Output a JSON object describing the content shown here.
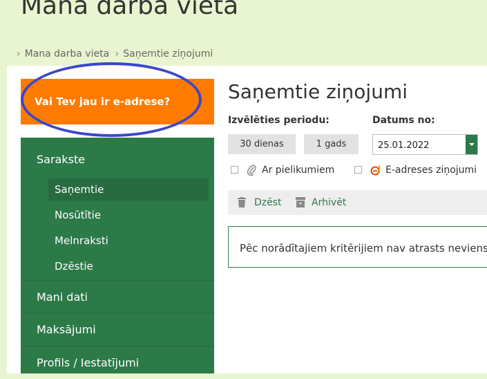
{
  "header": {
    "title": "Mana darba vieta"
  },
  "breadcrumb": {
    "items": [
      "Mana darba vieta",
      "Saņemtie ziņojumi"
    ],
    "separator": "›"
  },
  "promo": {
    "text": "Vai Tev jau ir e-adrese?",
    "color": "#ff7a00",
    "highlight_color": "#3b47c9"
  },
  "sidebar": {
    "color": "#2c7a48",
    "section_title": "Sarakste",
    "sub_items": [
      {
        "label": "Saņemtie",
        "active": true
      },
      {
        "label": "Nosūtītie",
        "active": false
      },
      {
        "label": "Melnraksti",
        "active": false
      },
      {
        "label": "Dzēstie",
        "active": false
      }
    ],
    "main_items": [
      {
        "label": "Mani dati"
      },
      {
        "label": "Maksājumi"
      },
      {
        "label": "Profils / Iestatījumi"
      }
    ]
  },
  "main": {
    "title": "Saņemtie ziņojumi",
    "period_label": "Izvēlēties periodu:",
    "period_buttons": [
      "30 dienas",
      "1 gads"
    ],
    "date_label": "Datums no:",
    "date_value": "25.01.2022",
    "filters": [
      {
        "label": "Ar pielikumiem",
        "icon": "paperclip-icon",
        "checked": false
      },
      {
        "label": "E-adreses ziņojumi",
        "icon": "e-address-icon",
        "checked": false
      }
    ],
    "toolbar": {
      "delete_label": "Dzēst",
      "archive_label": "Arhivēt"
    },
    "empty_message": "Pēc norādītajiem kritērijiem nav atrasts neviens z"
  }
}
